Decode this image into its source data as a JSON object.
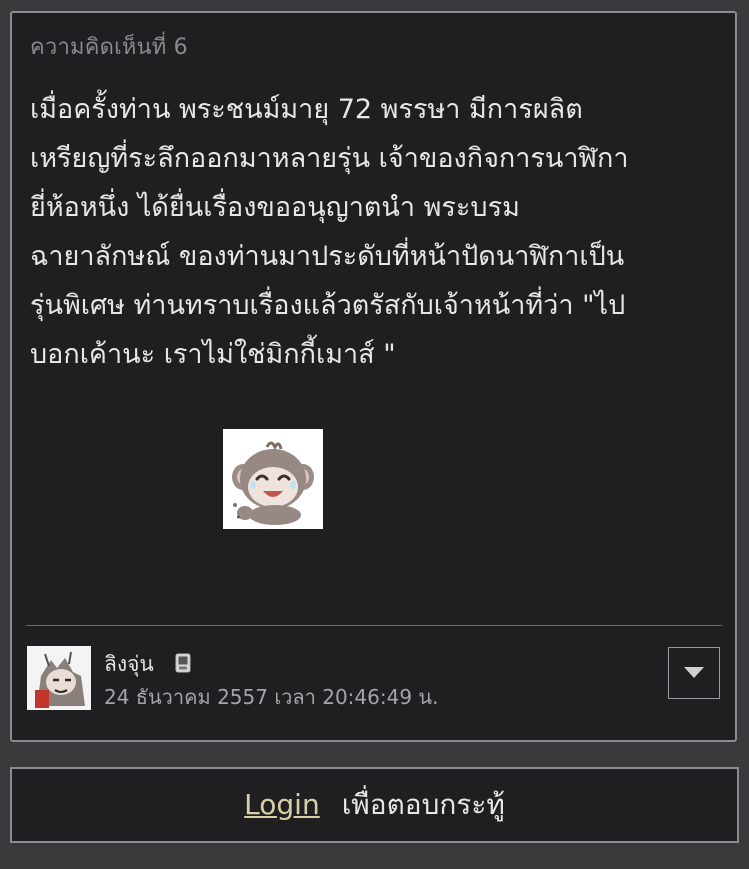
{
  "comment": {
    "number_label": "ความคิดเห็นที่ 6",
    "body": "เมื่อครั้งท่าน พระชนม์มายุ 72 พรรษา มีการผลิต\nเหรียญที่ระลึกออกมาหลายรุ่น เจ้าของกิจการนาฬิกา\nยี่ห้อหนึ่ง ได้ยื่นเรื่องขออนุญาตนำ พระบรม\nฉายาลักษณ์ ของท่านมาประดับที่หน้าปัดนาฬิกาเป็น\nรุ่นพิเศษ ท่านทราบเรื่องแล้วตรัสกับเจ้าหน้าที่ว่า \"ไป\nบอกเค้านะ เราไม่ใช่มิกกี้เมาส์ \"",
    "sticker_icon": "laughing-monkey-sticker",
    "author": {
      "name": "ลิงจุ่น",
      "avatar_icon": "monkey-avatar",
      "device_icon": "mobile-device-icon"
    },
    "timestamp": "24 ธันวาคม 2557 เวลา 20:46:49 น.",
    "menu_icon": "caret-down-icon"
  },
  "reply_bar": {
    "login_label": "Login",
    "text": "เพื่อตอบกระทู้"
  },
  "colors": {
    "page_bg": "#3a3a3c",
    "panel_bg": "#1f1f22",
    "border": "#8c8c90",
    "text": "#e6e6e6",
    "muted": "#8a8a8e",
    "link": "#d9cfa6"
  }
}
